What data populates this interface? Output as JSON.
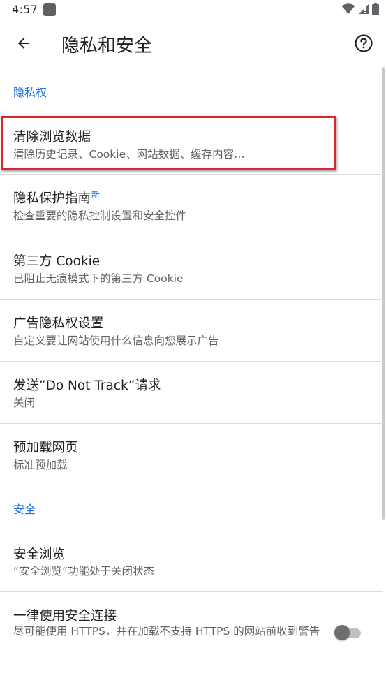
{
  "status_bar": {
    "time": "4:57",
    "icons": [
      "app-notification-icon",
      "wifi-icon",
      "cellular-signal-icon",
      "battery-icon"
    ]
  },
  "toolbar": {
    "title": "隐私和安全",
    "back_icon": "arrow-left-icon",
    "help_icon": "help-circle-icon"
  },
  "sections": {
    "privacy": {
      "header": "隐私权",
      "items": [
        {
          "title": "清除浏览数据",
          "subtitle": "清除历史记录、Cookie、网站数据、缓存内容…"
        },
        {
          "title": "隐私保护指南",
          "badge": "新",
          "subtitle": "检查重要的隐私控制设置和安全控件"
        },
        {
          "title": "第三方 Cookie",
          "subtitle": "已阻止无痕模式下的第三方 Cookie"
        },
        {
          "title": "广告隐私权设置",
          "subtitle": "自定义要让网站使用什么信息向您展示广告"
        },
        {
          "title": "发送“Do Not Track”请求",
          "subtitle": "关闭"
        },
        {
          "title": "预加载网页",
          "subtitle": "标准预加载"
        }
      ]
    },
    "security": {
      "header": "安全",
      "items": [
        {
          "title": "安全浏览",
          "subtitle": "“安全浏览”功能处于关闭状态"
        },
        {
          "title": "一律使用安全连接",
          "subtitle": "尽可能使用 HTTPS，并在加载不支持 HTTPS 的网站前收到警告",
          "toggle_on": false
        }
      ]
    }
  },
  "colors": {
    "accent": "#1a73e8",
    "highlight_border": "#d9262c",
    "text_primary": "#202124",
    "text_secondary": "#5f6368"
  }
}
